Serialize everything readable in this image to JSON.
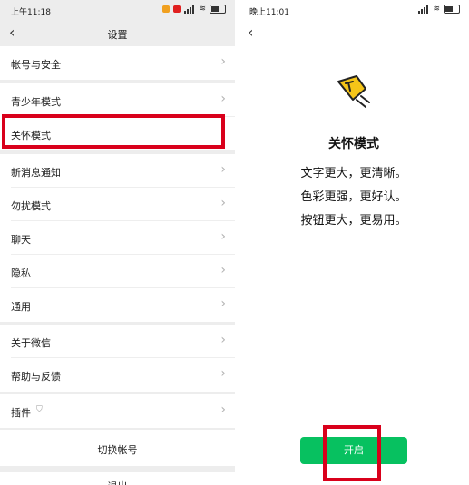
{
  "left": {
    "status": {
      "time": "上午11:18"
    },
    "nav_title": "设置",
    "items": [
      {
        "label": "帐号与安全"
      },
      {
        "label": "青少年模式"
      },
      {
        "label": "关怀模式"
      },
      {
        "label": "新消息通知"
      },
      {
        "label": "勿扰模式"
      },
      {
        "label": "聊天"
      },
      {
        "label": "隐私"
      },
      {
        "label": "通用"
      },
      {
        "label": "关于微信"
      },
      {
        "label": "帮助与反馈"
      },
      {
        "label": "插件"
      }
    ],
    "switch_account": "切换帐号",
    "logout": "退出"
  },
  "right": {
    "status": {
      "time": "晚上11:01"
    },
    "title": "关怀模式",
    "lines": [
      "文字更大，更清晰。",
      "色彩更强，更好认。",
      "按钮更大，更易用。"
    ],
    "open_button": "开启"
  },
  "colors": {
    "accent": "#07c160",
    "highlight": "#d9001b",
    "icon_yellow": "#f5c518"
  }
}
